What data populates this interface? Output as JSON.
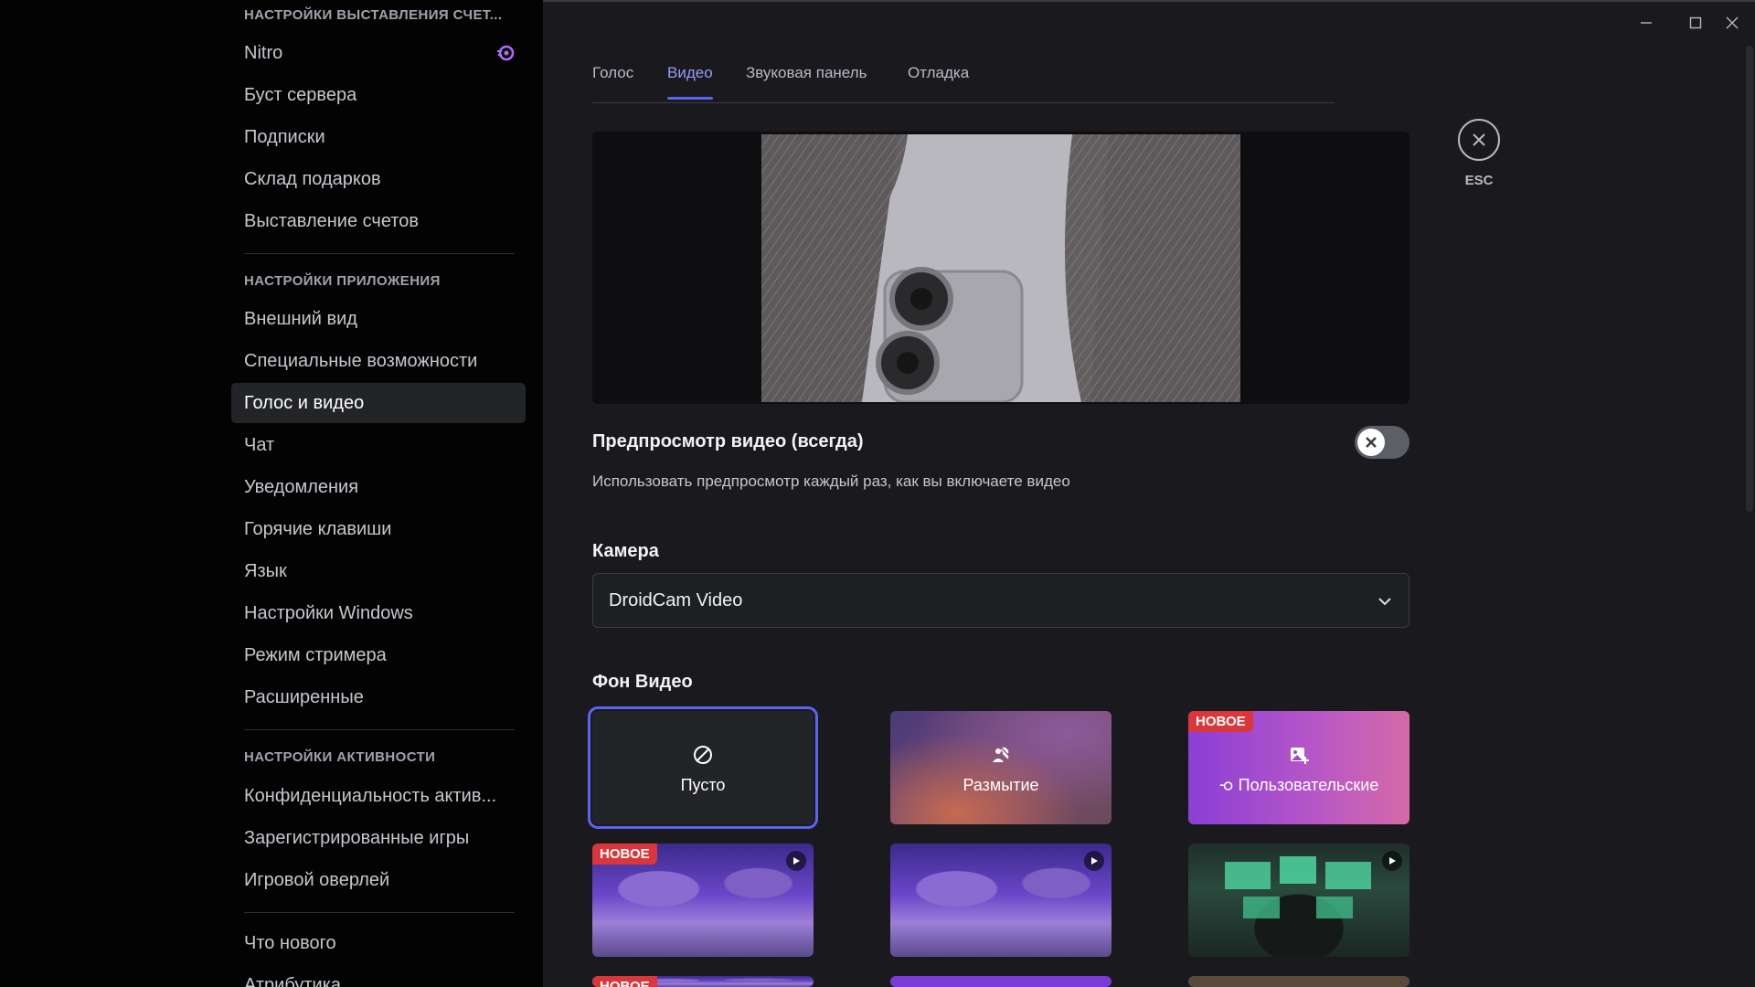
{
  "sidebar": {
    "billing_header": "НАСТРОЙКИ ВЫСТАВЛЕНИЯ СЧЕТ...",
    "billing_items": [
      {
        "label": "Nitro"
      },
      {
        "label": "Буст сервера"
      },
      {
        "label": "Подписки"
      },
      {
        "label": "Склад подарков"
      },
      {
        "label": "Выставление счетов"
      }
    ],
    "app_header": "НАСТРОЙКИ ПРИЛОЖЕНИЯ",
    "app_items": [
      {
        "label": "Внешний вид"
      },
      {
        "label": "Специальные возможности"
      },
      {
        "label": "Голос и видео"
      },
      {
        "label": "Чат"
      },
      {
        "label": "Уведомления"
      },
      {
        "label": "Горячие клавиши"
      },
      {
        "label": "Язык"
      },
      {
        "label": "Настройки Windows"
      },
      {
        "label": "Режим стримера"
      },
      {
        "label": "Расширенные"
      }
    ],
    "activity_header": "НАСТРОЙКИ АКТИВНОСТИ",
    "activity_items": [
      {
        "label": "Конфиденциальность актив..."
      },
      {
        "label": "Зарегистрированные игры"
      },
      {
        "label": "Игровой оверлей"
      }
    ],
    "misc_items": [
      {
        "label": "Что нового"
      },
      {
        "label": "Атрибутика"
      }
    ],
    "active_item": "Голос и видео",
    "nitro_icon": "nitro-icon"
  },
  "tabs": [
    {
      "label": "Голос"
    },
    {
      "label": "Видео"
    },
    {
      "label": "Звуковая панель"
    },
    {
      "label": "Отладка"
    }
  ],
  "active_tab": "Видео",
  "close": {
    "esc_label": "ESC"
  },
  "video_preview": {
    "always_title": "Предпросмотр видео (всегда)",
    "always_desc": "Использовать предпросмотр каждый раз, как вы включаете видео",
    "toggle_on": false
  },
  "camera": {
    "label": "Камера",
    "selected": "DroidCam Video"
  },
  "backgrounds": {
    "label": "Фон Видео",
    "new_badge": "НОВОЕ",
    "cards": [
      {
        "label": "Пусто",
        "icon": "none-icon",
        "selected": true
      },
      {
        "label": "Размытие",
        "icon": "blur-icon"
      },
      {
        "label": "Пользовательские",
        "icon": "add-image-icon",
        "badge": "НОВОЕ"
      }
    ]
  },
  "colors": {
    "accent": "#5865f2",
    "badge_red": "#da373c",
    "sidebar_bg": "#030304",
    "content_bg": "#1a1a1e"
  }
}
